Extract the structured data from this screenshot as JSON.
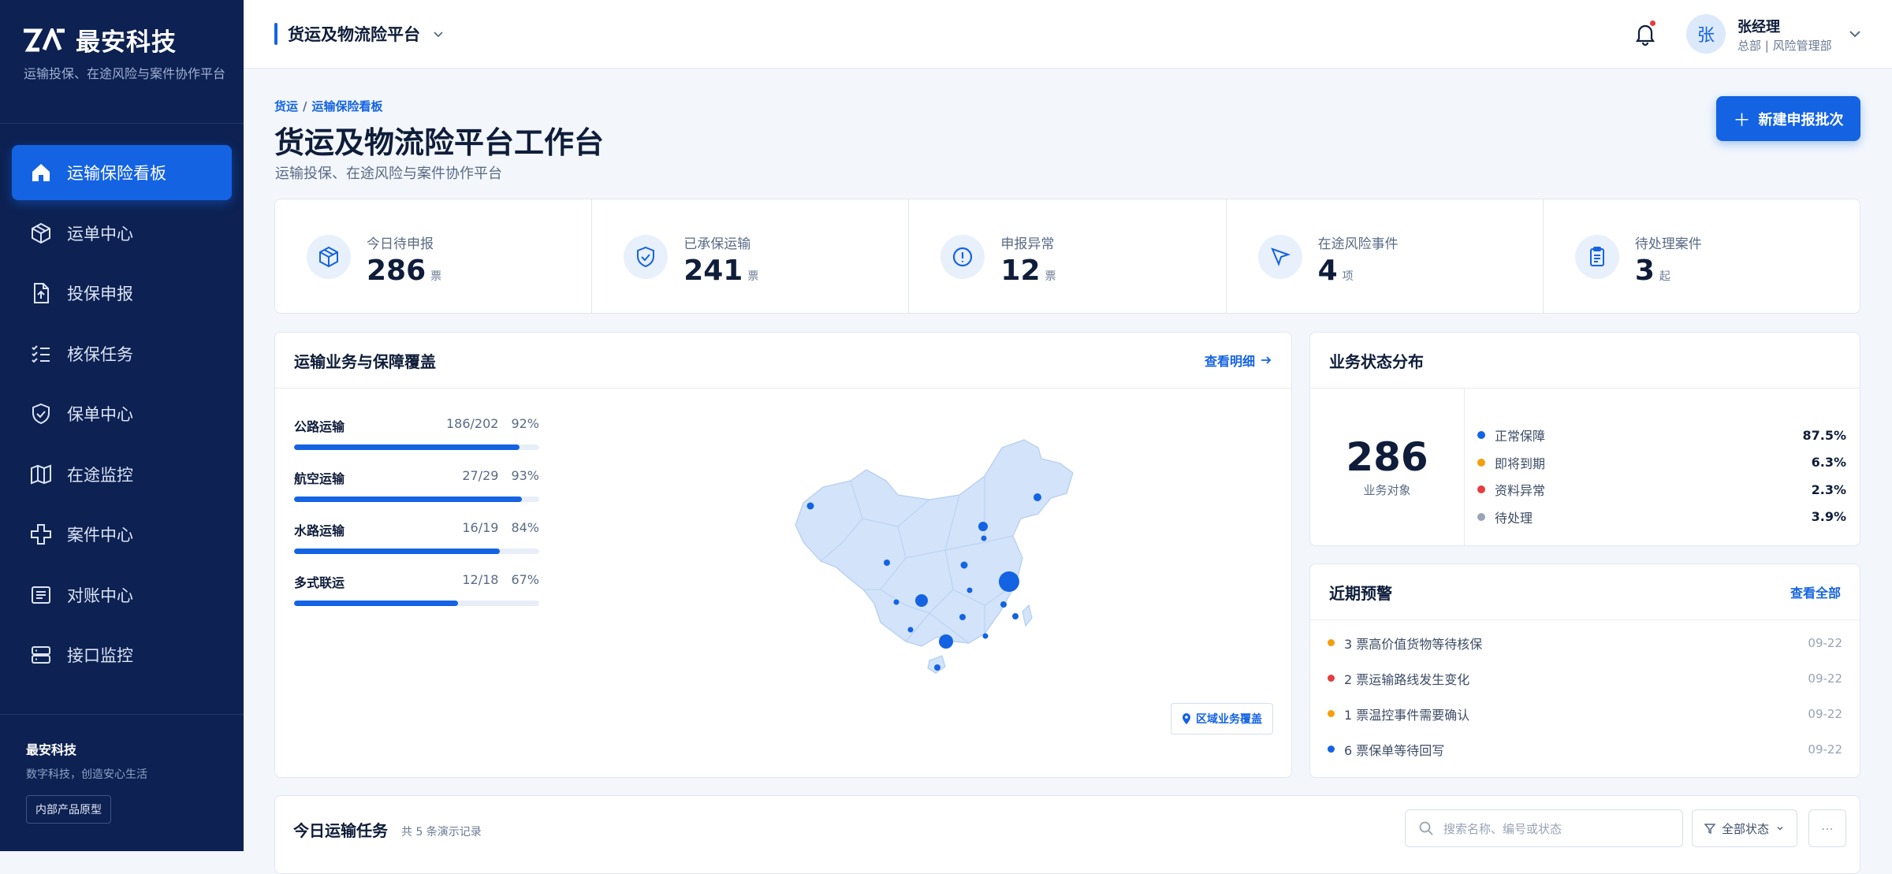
{
  "brand": {
    "name": "最安科技",
    "subtitle": "运输投保、在途风险与案件协作平台"
  },
  "sidebar": {
    "items": [
      {
        "label": "运输保险看板",
        "icon": "home-icon",
        "active": true
      },
      {
        "label": "运单中心",
        "icon": "package-icon"
      },
      {
        "label": "投保申报",
        "icon": "file-upload-icon"
      },
      {
        "label": "核保任务",
        "icon": "checklist-icon"
      },
      {
        "label": "保单中心",
        "icon": "shield-check-icon"
      },
      {
        "label": "在途监控",
        "icon": "map-icon"
      },
      {
        "label": "案件中心",
        "icon": "medical-cross-icon"
      },
      {
        "label": "对账中心",
        "icon": "receipt-icon"
      },
      {
        "label": "接口监控",
        "icon": "server-icon"
      }
    ],
    "footer": {
      "title": "最安科技",
      "slogan": "数字科技，创造安心生活",
      "tag": "内部产品原型"
    }
  },
  "topbar": {
    "platform": "货运及物流险平台",
    "user": {
      "avatar": "张",
      "name": "张经理",
      "role": "总部 | 风险管理部"
    }
  },
  "page": {
    "breadcrumb": [
      "货运",
      "运输保险看板"
    ],
    "title": "货运及物流险平台工作台",
    "subtitle": "运输投保、在途风险与案件协作平台",
    "new_button": "新建申报批次"
  },
  "stats": [
    {
      "label": "今日待申报",
      "value": "286",
      "unit": "票",
      "icon": "box-icon"
    },
    {
      "label": "已承保运输",
      "value": "241",
      "unit": "票",
      "icon": "shield-check-icon"
    },
    {
      "label": "申报异常",
      "value": "12",
      "unit": "票",
      "icon": "alert-circle-icon"
    },
    {
      "label": "在途风险事件",
      "value": "4",
      "unit": "项",
      "icon": "navigation-icon"
    },
    {
      "label": "待处理案件",
      "value": "3",
      "unit": "起",
      "icon": "clipboard-icon"
    }
  ],
  "coverage": {
    "title": "运输业务与保障覆盖",
    "link": "查看明细",
    "rows": [
      {
        "name": "公路运输",
        "ratio": "186/202",
        "pct": "92%",
        "value": 0.92
      },
      {
        "name": "航空运输",
        "ratio": "27/29",
        "pct": "93%",
        "value": 0.93
      },
      {
        "name": "水路运输",
        "ratio": "16/19",
        "pct": "84%",
        "value": 0.84
      },
      {
        "name": "多式联运",
        "ratio": "12/18",
        "pct": "67%",
        "value": 0.67
      }
    ],
    "region_button": "区域业务覆盖"
  },
  "status": {
    "title": "业务状态分布",
    "total": "286",
    "total_caption": "业务对象",
    "rows": [
      {
        "label": "正常保障",
        "pct": "87.5%",
        "color": "#1463e3"
      },
      {
        "label": "即将到期",
        "pct": "6.3%",
        "color": "#f59e0b"
      },
      {
        "label": "资料异常",
        "pct": "2.3%",
        "color": "#e53e3e"
      },
      {
        "label": "待处理",
        "pct": "3.9%",
        "color": "#9aa5b8"
      }
    ]
  },
  "alerts": {
    "title": "近期预警",
    "link": "查看全部",
    "rows": [
      {
        "text": "3 票高价值货物等待核保",
        "date": "09-22",
        "color": "#f59e0b"
      },
      {
        "text": "2 票运输路线发生变化",
        "date": "09-22",
        "color": "#e53e3e"
      },
      {
        "text": "1 票温控事件需要确认",
        "date": "09-22",
        "color": "#f59e0b"
      },
      {
        "text": "6 票保单等待回写",
        "date": "09-22",
        "color": "#1463e3"
      }
    ]
  },
  "tasks": {
    "title": "今日运输任务",
    "count": "共 5 条演示记录",
    "search_placeholder": "搜索名称、编号或状态",
    "filter": "全部状态",
    "more": "⋯"
  }
}
